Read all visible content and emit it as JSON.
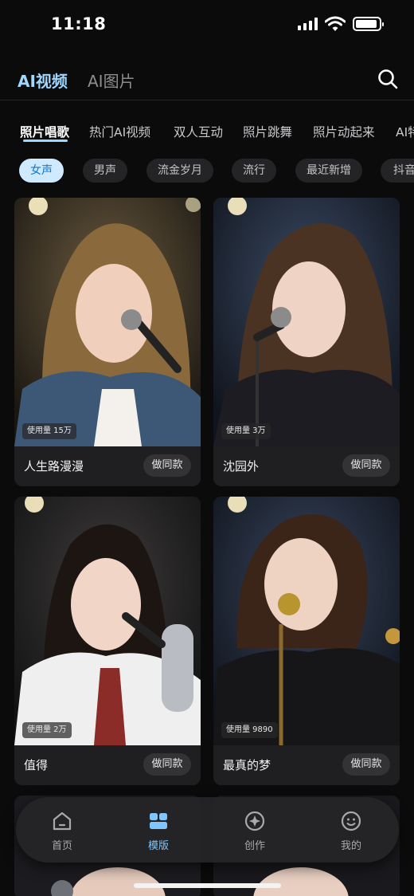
{
  "status_bar": {
    "time": "11:18"
  },
  "top_tabs": [
    {
      "label": "AI视频",
      "active": true
    },
    {
      "label": "AI图片",
      "active": false
    }
  ],
  "categories": [
    "照片唱歌",
    "热门AI视频",
    "双人互动",
    "照片跳舞",
    "照片动起来",
    "AI特"
  ],
  "chips": [
    "女声",
    "男声",
    "流金岁月",
    "流行",
    "最近新增",
    "抖音"
  ],
  "cards": [
    {
      "title": "人生路漫漫",
      "usage": "使用量 15万",
      "button": "做同款"
    },
    {
      "title": "沈园外",
      "usage": "使用量 3万",
      "button": "做同款"
    },
    {
      "title": "值得",
      "usage": "使用量 2万",
      "button": "做同款"
    },
    {
      "title": "最真的梦",
      "usage": "使用量 9890",
      "button": "做同款"
    }
  ],
  "bottom_nav": [
    {
      "label": "首页",
      "icon": "home-icon",
      "active": false
    },
    {
      "label": "模版",
      "icon": "templates-icon",
      "active": true
    },
    {
      "label": "创作",
      "icon": "create-icon",
      "active": false
    },
    {
      "label": "我的",
      "icon": "profile-icon",
      "active": false
    }
  ],
  "colors": {
    "accent": "#9fd7ff",
    "chip_active_bg": "#cfe9ff",
    "chip_active_text": "#1477c7",
    "background": "#0b0b0c"
  }
}
